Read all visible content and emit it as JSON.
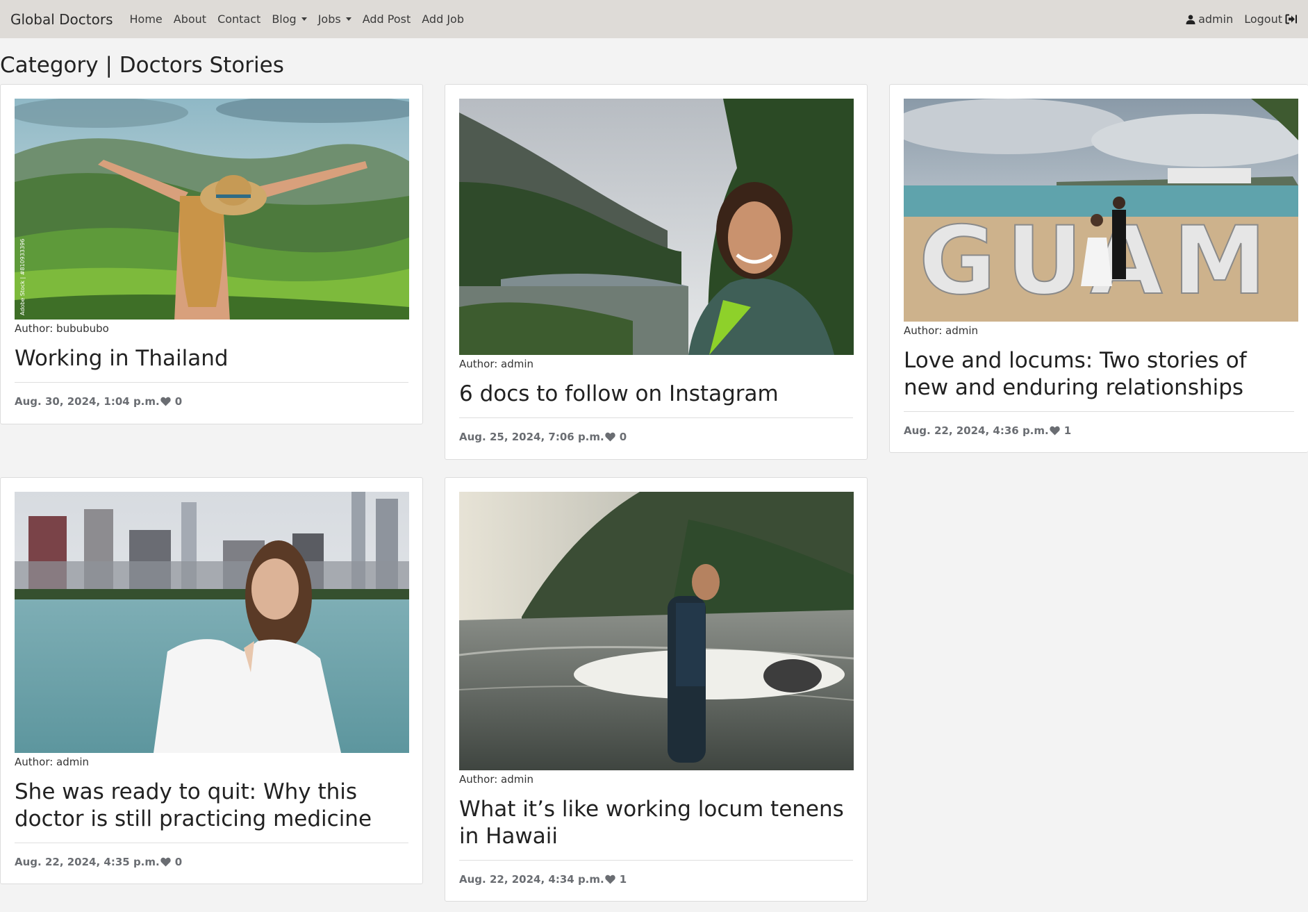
{
  "navbar": {
    "brand": "Global Doctors",
    "links": [
      {
        "label": "Home"
      },
      {
        "label": "About"
      },
      {
        "label": "Contact"
      },
      {
        "label": "Blog"
      },
      {
        "label": "Jobs"
      },
      {
        "label": "Add Post"
      },
      {
        "label": "Add Job"
      }
    ],
    "user": "admin",
    "logout": "Logout"
  },
  "page": {
    "title": "Category | Doctors Stories"
  },
  "posts": [
    {
      "author": "Author: bubububo",
      "title": "Working in Thailand",
      "date": "Aug. 30, 2024, 1:04 p.m.",
      "likes": "0",
      "image": "woman-in-hat-tea-plantation-photo",
      "watermark": "Adobe Stock | #810933396"
    },
    {
      "author": "Author: admin",
      "title": "6 docs to follow on Instagram",
      "date": "Aug. 25, 2024, 7:06 p.m.",
      "likes": "0",
      "image": "woman-selfie-river-mountains-photo"
    },
    {
      "author": "Author: admin",
      "title": "Love and locums: Two stories of new and enduring relationships",
      "date": "Aug. 22, 2024, 4:36 p.m.",
      "likes": "1",
      "image": "wedding-couple-guam-sign-photo",
      "sign_text": "GUAM"
    },
    {
      "author": "Author: admin",
      "title": "She was ready to quit: Why this doctor is still practicing medicine",
      "date": "Aug. 22, 2024, 4:35 p.m.",
      "likes": "0",
      "image": "doctor-white-coat-city-skyline-photo"
    },
    {
      "author": "Author: admin",
      "title": "What it’s like working locum tenens in Hawaii",
      "date": "Aug. 22, 2024, 4:34 p.m.",
      "likes": "1",
      "image": "surfer-beach-cliffs-photo"
    }
  ]
}
